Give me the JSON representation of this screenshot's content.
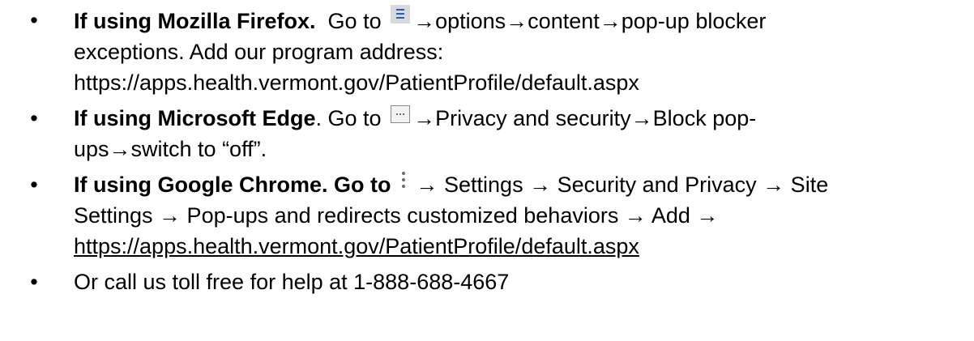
{
  "bullets": [
    {
      "lead": "If using Mozilla Firefox.",
      "text_before_icon": "Go to",
      "icon": "hamburger-menu-icon",
      "steps": "→options→content→pop-up blocker",
      "line2": "exceptions. Add our program address:",
      "line3": "https://apps.health.vermont.gov/PatientProfile/default.aspx"
    },
    {
      "lead": "If using Microsoft Edge",
      "lead_punct": ". Go to",
      "icon": "ellipsis-menu-icon",
      "steps": "→Privacy and security→Block pop-",
      "line2": "ups→switch to “off”."
    },
    {
      "lead": "If using Google Chrome. Go to",
      "icon": "vertical-dots-menu-icon",
      "steps": " → Settings → Security and Privacy → Site",
      "line2": "Settings → Pop-ups and redirects customized behaviors → Add →",
      "link": "https://apps.health.vermont.gov/PatientProfile/default.aspx"
    },
    {
      "text": "Or call us toll free for help at 1-888-688-4667"
    }
  ],
  "bullet_char": "•",
  "colors": {
    "text": "#000000",
    "firefox_icon_bg": "#d9d9d9",
    "firefox_icon_lines": "#1f5fbf",
    "edge_icon_bg": "#f2f2f2",
    "edge_icon_border": "#8a8a8a",
    "chrome_icon_dots": "#6b6b6b"
  }
}
